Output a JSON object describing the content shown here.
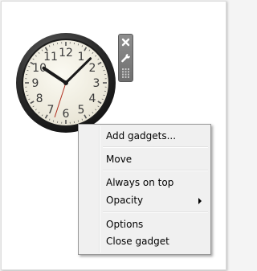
{
  "clock": {
    "numerals": [
      "12",
      "1",
      "2",
      "3",
      "4",
      "5",
      "6",
      "7",
      "8",
      "9",
      "10",
      "11"
    ],
    "time": {
      "hour": 10,
      "minute": 7,
      "second": 33
    }
  },
  "toolbar": {
    "close_icon": "close-icon",
    "options_icon": "wrench-icon",
    "drag_icon": "drag-grip-icon"
  },
  "context_menu": {
    "add_gadgets": "Add gadgets...",
    "move": "Move",
    "always_on_top": "Always on top",
    "opacity": "Opacity",
    "options": "Options",
    "close_gadget": "Close gadget"
  }
}
